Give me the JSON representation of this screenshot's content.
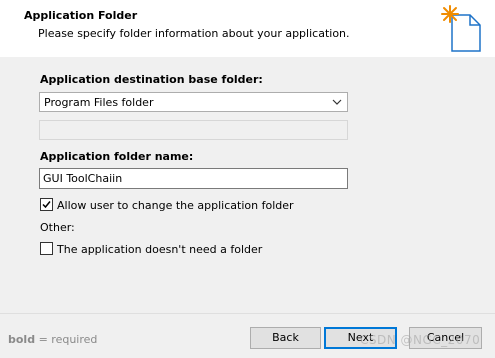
{
  "header": {
    "title": "Application Folder",
    "subtitle": "Please specify folder information about your application."
  },
  "destination": {
    "label": "Application destination base folder:",
    "selected": "Program Files folder",
    "path_value": ""
  },
  "folder_name": {
    "label": "Application folder name:",
    "value": "GUI ToolChaiin"
  },
  "allow_change": {
    "label": "Allow user to change the application folder",
    "checked": true
  },
  "other": {
    "label": "Other:",
    "no_folder_label": "The application doesn't need a folder",
    "no_folder_checked": false
  },
  "footer": {
    "legend_bold": "bold",
    "legend_rest": " = required",
    "back": "Back",
    "next": "Next",
    "cancel": "Cancel"
  },
  "watermark": "CSDN @NGC_2070",
  "colors": {
    "accent": "#0078d7",
    "icon_star": "#f08c00"
  }
}
